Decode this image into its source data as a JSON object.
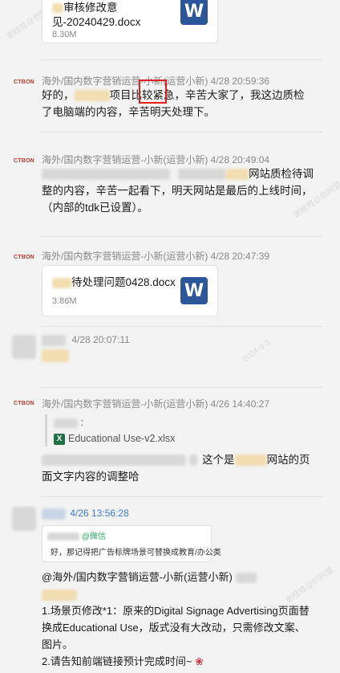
{
  "messages": {
    "m0": {
      "file_name_line1": "审核修改意",
      "file_name_line2": "见-20240429.docx",
      "file_size": "8.30M"
    },
    "m1": {
      "sender": "海外/国内数字营销运营-小新(运营小新)",
      "time": "4/28 20:59:36",
      "text_a": "好的，",
      "text_b": "项目比较",
      "text_hl": "紧急",
      "text_c": "，辛苦大家了，我这边质检了电脑端的内容，辛苦明天处理下。"
    },
    "m2": {
      "sender": "海外/国内数字营销运营-小新(运营小新)",
      "time": "4/28 20:49:04",
      "text_a": "网站质检待调整的内容，辛苦一起看下，明天网站是最后的上线时间，（内部的tdk已设置）。"
    },
    "m3": {
      "sender": "海外/国内数字营销运营-小新(运营小新)",
      "time": "4/28 20:47:39",
      "file_name": "待处理问题0428.docx",
      "file_size": "3.86M"
    },
    "m4": {
      "time": "4/28 20:07:11"
    },
    "m5": {
      "sender": "海外/国内数字营销运营-小新(运营小新)",
      "time": "4/26 14:40:27",
      "quote_colon": ":",
      "quote_file": "Educational Use-v2.xlsx",
      "text_a": "这个是",
      "text_b": "网站的页面文字内容的调整哈"
    },
    "m6": {
      "time": "4/26 13:56:28",
      "wx_tag": "@微信",
      "wx_text": "好，那记得把广告标牌场景可替换成教育/办公类",
      "mention": "@海外/国内数字营销运营-小新(运营小新)",
      "line1": "1.场景页修改*1：原来的Digital Signage Advertising页面替换成Educational Use，版式没有大改动，只需修改文案、图片。",
      "line2": "2.请告知前端链接预计完成时间~"
    }
  },
  "avatar_label": "CTBON",
  "watermark": {
    "a": "谢桂姓@创网盟",
    "b": "2024-9-3"
  },
  "icons": {
    "word": "word-file-icon",
    "excel": "excel-file-icon",
    "rose": "rose-emoji-icon"
  },
  "colors": {
    "highlight": "#e02020",
    "word": "#2b579a",
    "excel": "#1e7145",
    "brand": "#c0392b"
  }
}
